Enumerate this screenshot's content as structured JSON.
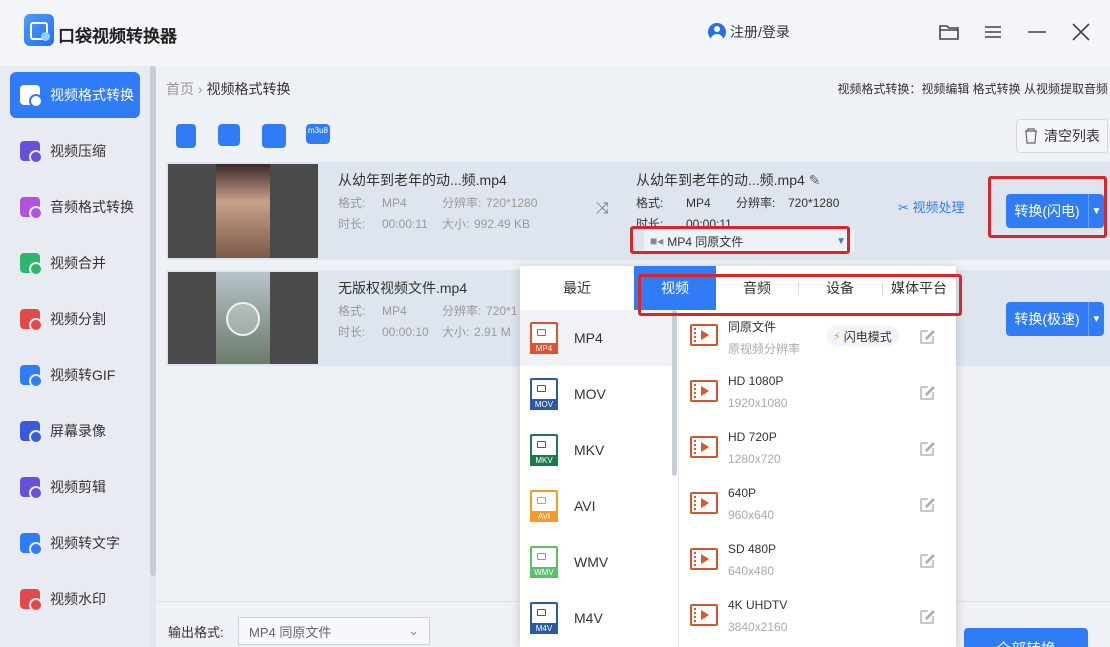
{
  "app": {
    "title": "口袋视频转换器",
    "login": "注册/登录"
  },
  "sidebar": {
    "items": [
      {
        "label": "视频格式转换",
        "color": "#ffffff",
        "active": true
      },
      {
        "label": "视频压缩",
        "color": "#6a4fd8"
      },
      {
        "label": "音频格式转换",
        "color": "#b253e0"
      },
      {
        "label": "视频合并",
        "color": "#2eb66b"
      },
      {
        "label": "视频分割",
        "color": "#e24a4a"
      },
      {
        "label": "视频转GIF",
        "color": "#2f7cf6"
      },
      {
        "label": "屏幕录像",
        "color": "#3a5bd9"
      },
      {
        "label": "视频剪辑",
        "color": "#6a4fd8"
      },
      {
        "label": "视频转文字",
        "color": "#2f7cf6"
      },
      {
        "label": "视频水印",
        "color": "#e24a4a"
      }
    ]
  },
  "breadcrumb": {
    "home": "首页",
    "sep": "›",
    "current": "视频格式转换"
  },
  "header_right": "视频格式转换：视频编辑 格式转换 从视频提取音频",
  "toolbar": {
    "clear": "清空列表",
    "icons": [
      "add-video-icon",
      "add-folder-icon",
      "dvd-icon",
      "m3u8-icon"
    ],
    "m3u8_label": "m3u8"
  },
  "files": [
    {
      "name": "从幼年到老年的动...频.mp4",
      "format_label": "格式:",
      "format": "MP4",
      "res_label": "分辨率:",
      "res": "720*1280",
      "dur_label": "时长:",
      "dur": "00:00:11",
      "size_label": "大小:",
      "size": "992.49 KB",
      "out_name": "从幼年到老年的动...频.mp4",
      "out_format": "MP4",
      "out_res": "720*1280",
      "out_dur": "00:00:11",
      "select": "MP4  同原文件",
      "process": "视频处理",
      "convert": "转换(闪电)"
    },
    {
      "name": "无版权视频文件.mp4",
      "format_label": "格式:",
      "format": "MP4",
      "res_label": "分辨率:",
      "res": "720*1",
      "dur_label": "时长:",
      "dur": "00:00:10",
      "size_label": "大小:",
      "size": "2.91 M",
      "convert": "转换(极速)"
    }
  ],
  "popup": {
    "tabs": [
      "最近",
      "视频",
      "音频",
      "设备",
      "媒体平台"
    ],
    "active_tab": "视频",
    "formats": [
      {
        "label": "MP4",
        "color": "#e0522e",
        "active": true
      },
      {
        "label": "MOV",
        "color": "#2c5aa0"
      },
      {
        "label": "MKV",
        "color": "#1f7a4a"
      },
      {
        "label": "AVI",
        "color": "#f39a2b"
      },
      {
        "label": "WMV",
        "color": "#5cbf6b"
      },
      {
        "label": "M4V",
        "color": "#2c5aa0"
      }
    ],
    "presets": [
      {
        "name": "同原文件",
        "sub": "原视频分辨率",
        "badge": "闪电模式"
      },
      {
        "name": "HD 1080P",
        "sub": "1920x1080"
      },
      {
        "name": "HD 720P",
        "sub": "1280x720"
      },
      {
        "name": "640P",
        "sub": "960x640"
      },
      {
        "name": "SD 480P",
        "sub": "640x480"
      },
      {
        "name": "4K UHDTV",
        "sub": "3840x2160"
      }
    ]
  },
  "bottom": {
    "out_label": "输出格式:",
    "out_value": "MP4  同原文件",
    "all_convert": "全部转换"
  },
  "colors": {
    "accent": "#2f7cf6",
    "highlight": "#d9262b"
  }
}
